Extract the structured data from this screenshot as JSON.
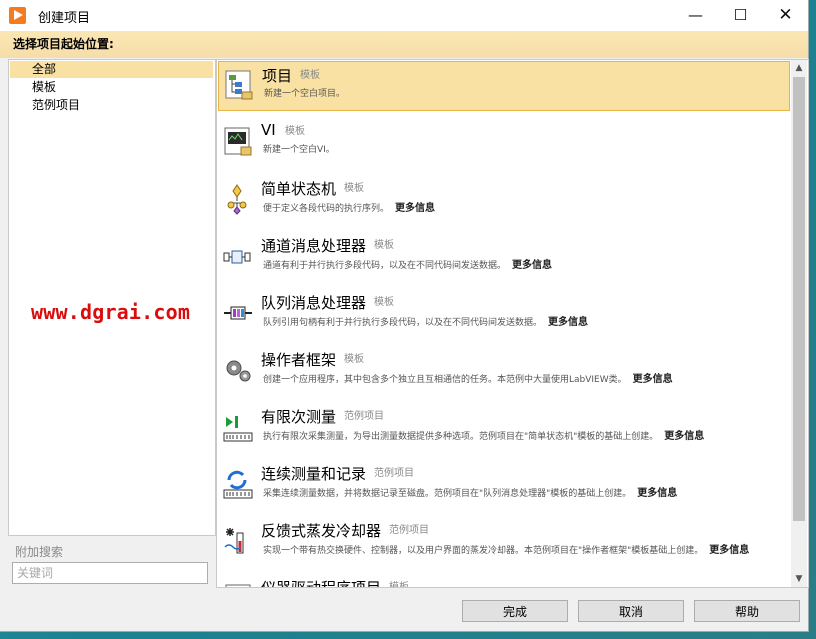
{
  "window": {
    "title": "创建项目",
    "minimize_glyph": "—",
    "maximize_glyph": "☐",
    "close_glyph": "✕"
  },
  "header": {
    "label": "选择项目起始位置:"
  },
  "categories": [
    {
      "label": "全部",
      "selected": true
    },
    {
      "label": "模板",
      "selected": false
    },
    {
      "label": "范例项目",
      "selected": false
    }
  ],
  "watermark": "www.dgrai.com",
  "search": {
    "label": "附加搜索",
    "placeholder": "关键词"
  },
  "templates": [
    {
      "title": "项目",
      "kind": "模板",
      "desc": "新建一个空白项目。",
      "more": "",
      "icon": "project-icon",
      "selected": true
    },
    {
      "title": "VI",
      "kind": "模板",
      "desc": "新建一个空白VI。",
      "more": "",
      "icon": "vi-icon"
    },
    {
      "title": "简单状态机",
      "kind": "模板",
      "desc": "便于定义各段代码的执行序列。",
      "more": "更多信息",
      "icon": "state-machine-icon"
    },
    {
      "title": "通道消息处理器",
      "kind": "模板",
      "desc": "通道有利于并行执行多段代码，以及在不同代码间发送数据。",
      "more": "更多信息",
      "icon": "channel-handler-icon"
    },
    {
      "title": "队列消息处理器",
      "kind": "模板",
      "desc": "队列引用句柄有利于并行执行多段代码，以及在不同代码间发送数据。",
      "more": "更多信息",
      "icon": "queue-handler-icon"
    },
    {
      "title": "操作者框架",
      "kind": "模板",
      "desc": "创建一个应用程序，其中包含多个独立且互相通信的任务。本范例中大量使用LabVIEW类。",
      "more": "更多信息",
      "icon": "gears-icon"
    },
    {
      "title": "有限次测量",
      "kind": "范例项目",
      "desc": "执行有限次采集测量，为导出测量数据提供多种选项。范例项目在\"简单状态机\"模板的基础上创建。",
      "more": "更多信息",
      "icon": "finite-measure-icon"
    },
    {
      "title": "连续测量和记录",
      "kind": "范例项目",
      "desc": "采集连续测量数据，并将数据记录至磁盘。范例项目在\"队列消息处理器\"模板的基础上创建。",
      "more": "更多信息",
      "icon": "continuous-measure-icon"
    },
    {
      "title": "反馈式蒸发冷却器",
      "kind": "范例项目",
      "desc": "实现一个带有热交换硬件、控制器，以及用户界面的蒸发冷却器。本范例项目在\"操作者框架\"模板基础上创建。",
      "more": "更多信息",
      "icon": "cooler-icon"
    },
    {
      "title": "仪器驱动程序项目",
      "kind": "模板",
      "desc": "",
      "more": "",
      "icon": "instrument-driver-icon"
    }
  ],
  "scrollbar": {
    "up_glyph": "▲",
    "down_glyph": "▼"
  },
  "buttons": {
    "finish": "完成",
    "cancel": "取消",
    "help": "帮助"
  },
  "colors": {
    "selection": "#f8e1a2",
    "header": "#f6ddaa",
    "watermark": "#d90d0d",
    "brand": "#f47b20"
  }
}
